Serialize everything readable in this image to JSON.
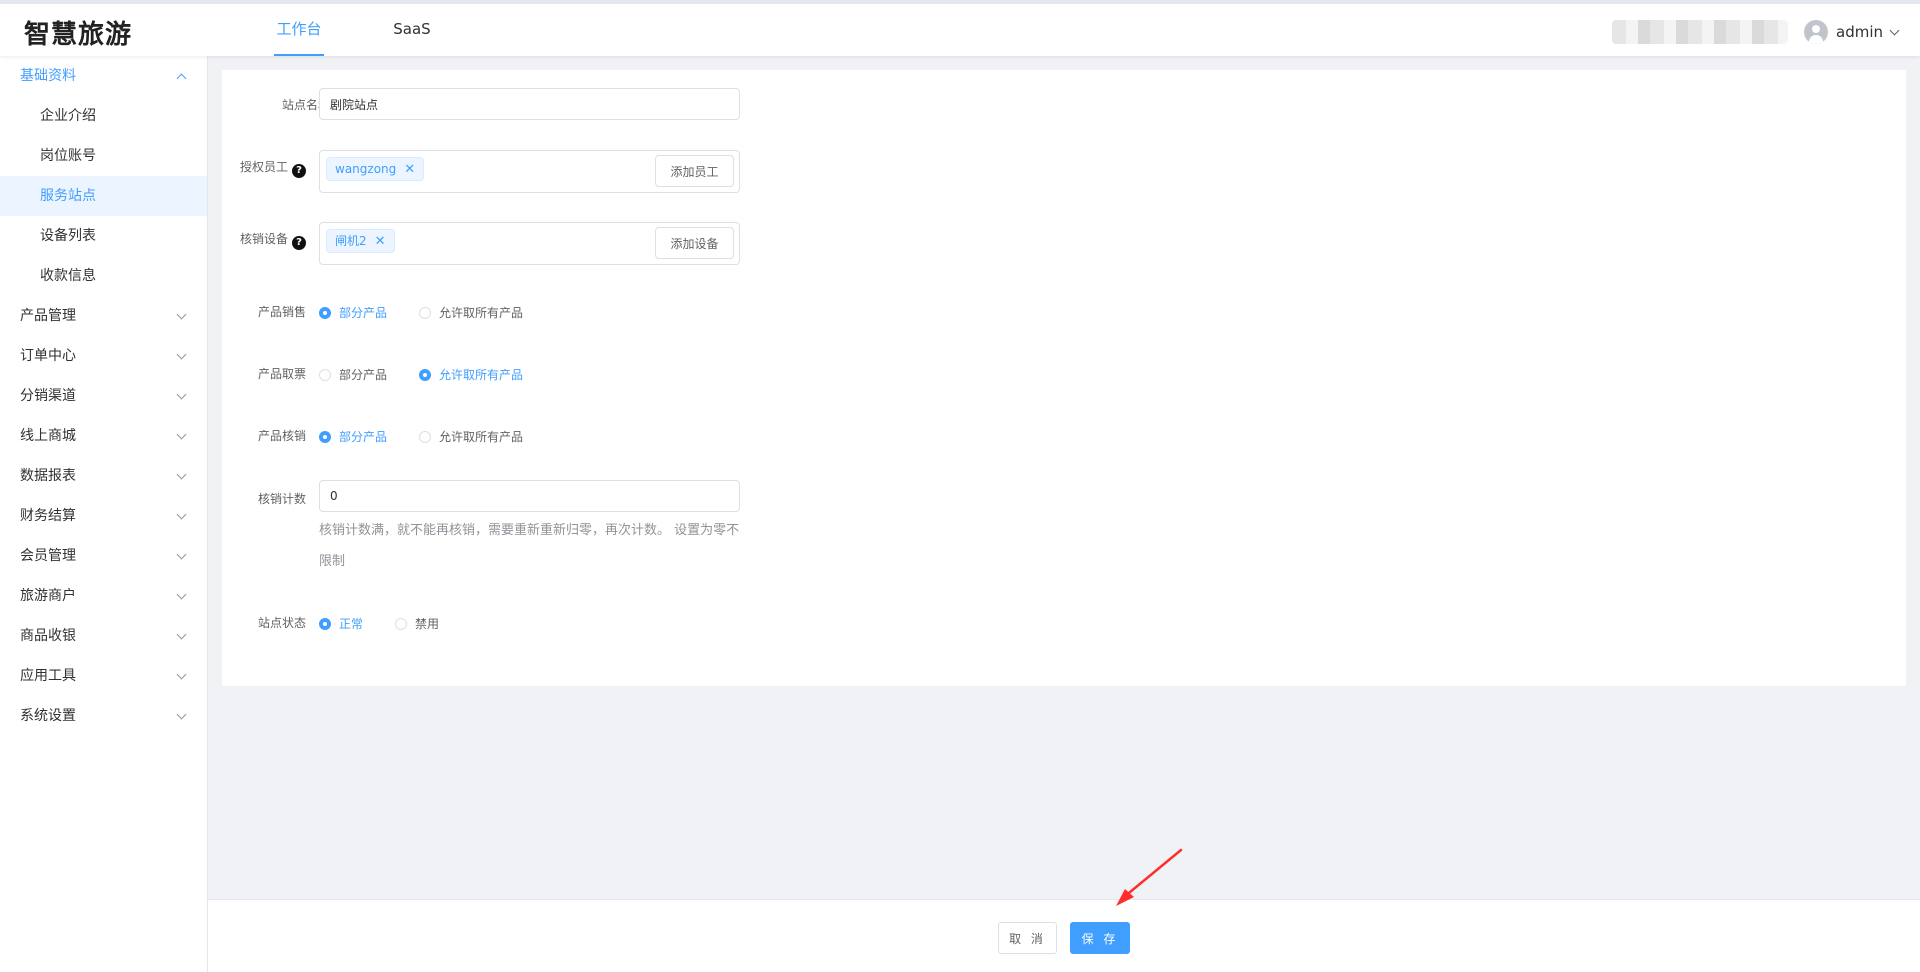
{
  "header": {
    "logo": "智慧旅游",
    "tabs": [
      {
        "label": "工作台",
        "active": true
      },
      {
        "label": "SaaS",
        "active": false
      }
    ],
    "user": "admin"
  },
  "sidebar": {
    "items": [
      {
        "label": "基础资料",
        "level": 1,
        "state": "open"
      },
      {
        "label": "企业介绍",
        "level": 2
      },
      {
        "label": "岗位账号",
        "level": 2
      },
      {
        "label": "服务站点",
        "level": 2,
        "state": "active"
      },
      {
        "label": "设备列表",
        "level": 2
      },
      {
        "label": "收款信息",
        "level": 2
      },
      {
        "label": "产品管理",
        "level": 1
      },
      {
        "label": "订单中心",
        "level": 1
      },
      {
        "label": "分销渠道",
        "level": 1
      },
      {
        "label": "线上商城",
        "level": 1
      },
      {
        "label": "数据报表",
        "level": 1
      },
      {
        "label": "财务结算",
        "level": 1
      },
      {
        "label": "会员管理",
        "level": 1
      },
      {
        "label": "旅游商户",
        "level": 1
      },
      {
        "label": "商品收银",
        "level": 1
      },
      {
        "label": "应用工具",
        "level": 1
      },
      {
        "label": "系统设置",
        "level": 1
      }
    ]
  },
  "form": {
    "site_name": {
      "label": "站点名称",
      "value": "剧院站点"
    },
    "staff": {
      "label": "授权员工",
      "help": "?",
      "tag": "wangzong",
      "tag_close": "✕",
      "button": "添加员工"
    },
    "device": {
      "label": "核销设备",
      "help": "?",
      "tag": "闸机2",
      "tag_close": "✕",
      "button": "添加设备"
    },
    "sale": {
      "label": "产品销售",
      "options": [
        "部分产品",
        "允许取所有产品"
      ],
      "selected": 0
    },
    "ticket": {
      "label": "产品取票",
      "options": [
        "部分产品",
        "允许取所有产品"
      ],
      "selected": 1
    },
    "verify": {
      "label": "产品核销",
      "options": [
        "部分产品",
        "允许取所有产品"
      ],
      "selected": 0
    },
    "count": {
      "label": "核销计数",
      "value": "0",
      "hint": "核销计数满，就不能再核销，需要重新重新归零，再次计数。 设置为零不限制"
    },
    "status": {
      "label": "站点状态",
      "options": [
        "正常",
        "禁用"
      ],
      "selected": 0
    }
  },
  "footer": {
    "cancel": "取 消",
    "save": "保 存"
  },
  "colors": {
    "accent": "#409eff",
    "arrow": "#ff2d2d"
  }
}
